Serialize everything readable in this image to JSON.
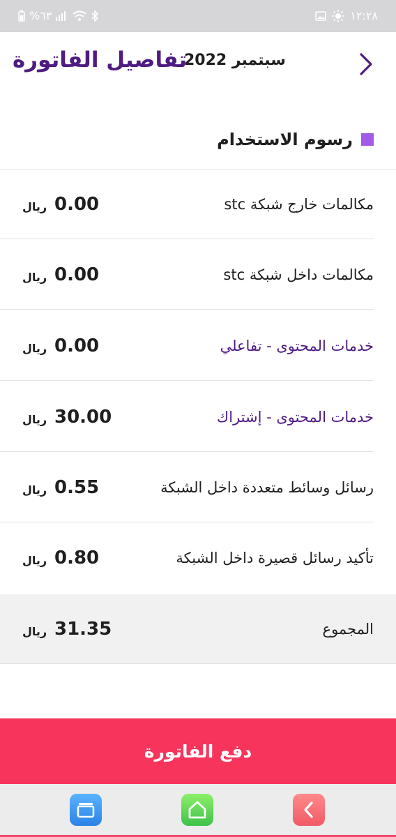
{
  "status_bar": {
    "time": "١٢:٢٨",
    "battery": "%٦٣",
    "icons": [
      "image-notification-icon",
      "brightness-icon",
      "battery-icon",
      "signal-icon",
      "wifi-icon",
      "bluetooth-icon"
    ]
  },
  "header": {
    "title": "تفاصيل الفاتورة",
    "date": "سبتمبر 2022",
    "back_icon": "chevron-right-icon"
  },
  "section": {
    "title": "رسوم الاستخدام",
    "accent_color": "#a35ae6"
  },
  "charges": [
    {
      "label": "مكالمات خارج شبكة stc",
      "amount": "0.00",
      "currency": "ريال",
      "label_color": "#1f1f1f"
    },
    {
      "label": "مكالمات داخل شبكة stc",
      "amount": "0.00",
      "currency": "ريال",
      "label_color": "#1f1f1f"
    },
    {
      "label": "خدمات المحتوى - تفاعلي",
      "amount": "0.00",
      "currency": "ريال",
      "label_color": "#4f1c82"
    },
    {
      "label": "خدمات المحتوى - إشتراك",
      "amount": "30.00",
      "currency": "ريال",
      "label_color": "#4f1c82"
    },
    {
      "label": "رسائل وسائط متعددة داخل الشبكة",
      "amount": "0.55",
      "currency": "ريال",
      "label_color": "#1f1f1f"
    },
    {
      "label": "تأكيد رسائل قصيرة داخل الشبكة",
      "amount": "0.80",
      "currency": "ريال",
      "label_color": "#1f1f1f"
    }
  ],
  "total": {
    "label": "المجموع",
    "amount": "31.35",
    "currency": "ريال"
  },
  "pay_button": {
    "label": "دفع الفاتورة",
    "color": "#f7355c"
  },
  "nav_bar": {
    "buttons": [
      "recents-icon",
      "home-icon",
      "back-icon"
    ]
  },
  "colors": {
    "brand_purple": "#4f1c82",
    "accent": "#f7355c"
  }
}
